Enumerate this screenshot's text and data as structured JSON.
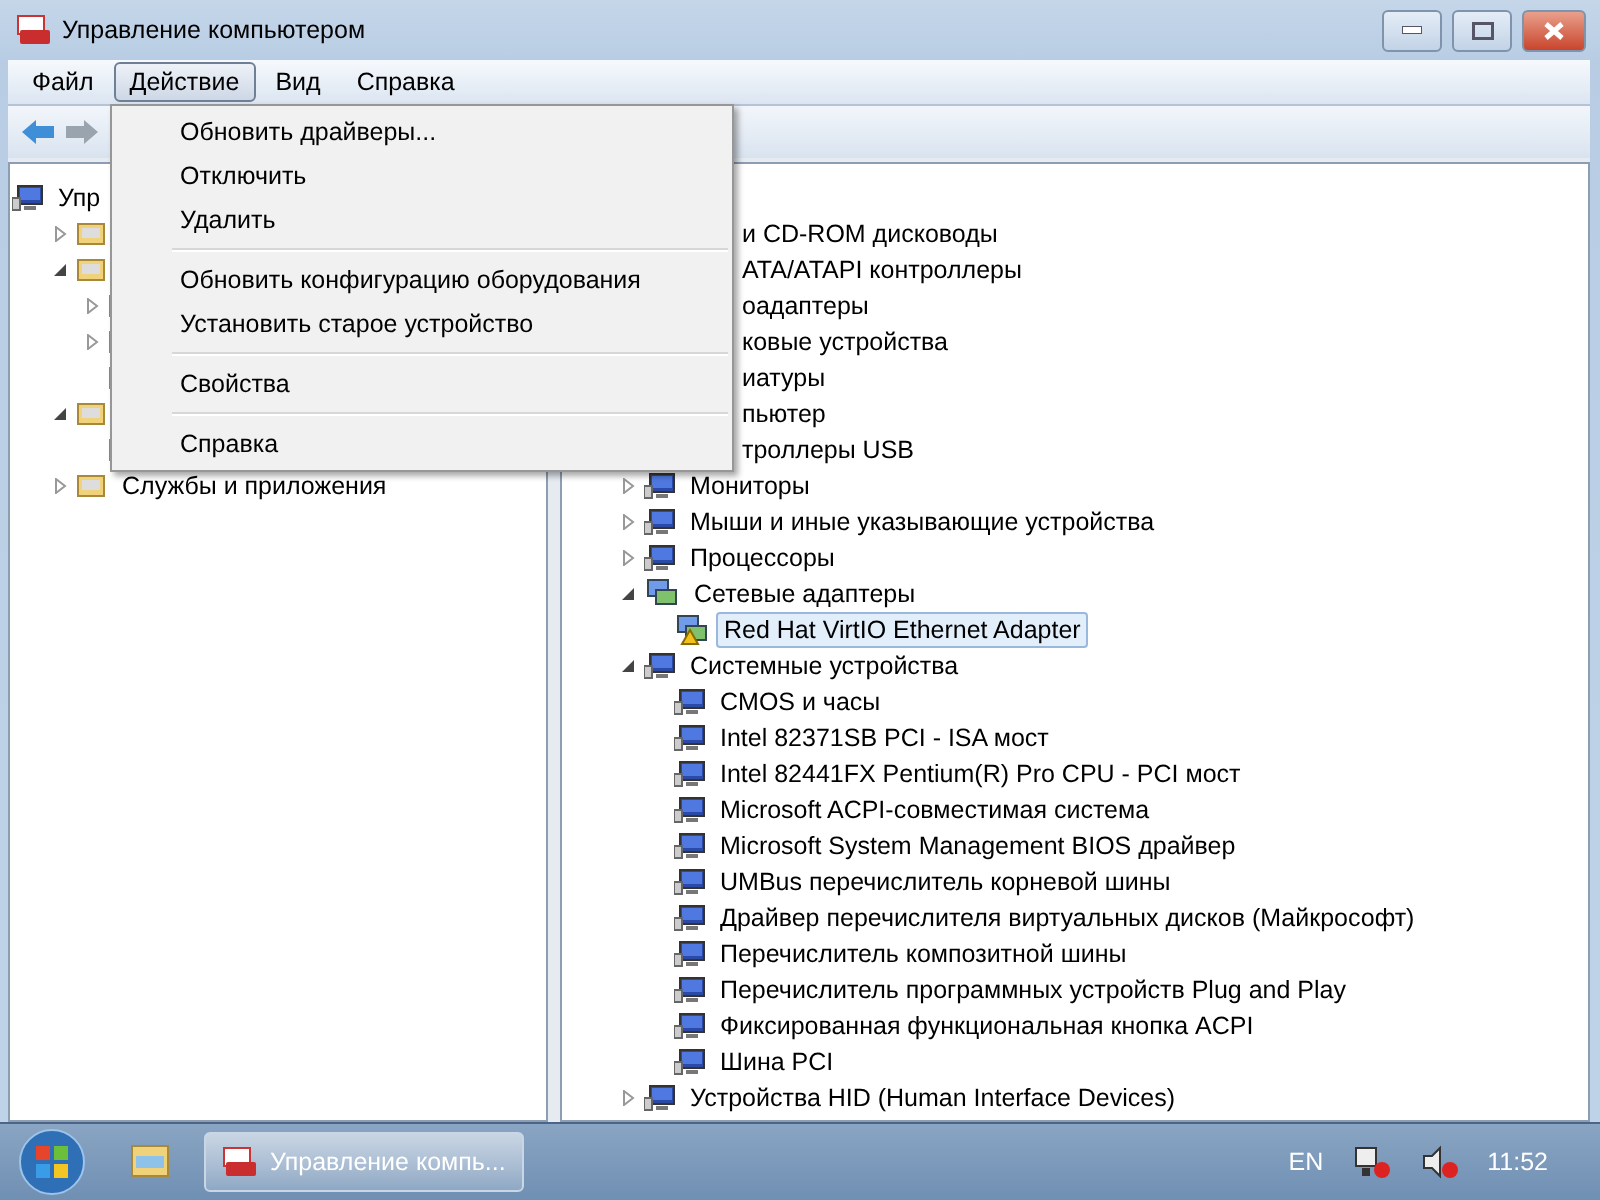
{
  "window": {
    "title": "Управление компьютером"
  },
  "menubar": [
    {
      "label": "Файл",
      "selected": false
    },
    {
      "label": "Действие",
      "selected": true
    },
    {
      "label": "Вид",
      "selected": false
    },
    {
      "label": "Справка",
      "selected": false
    }
  ],
  "action_menu": [
    {
      "kind": "item",
      "label": "Обновить драйверы..."
    },
    {
      "kind": "item",
      "label": "Отключить"
    },
    {
      "kind": "item",
      "label": "Удалить"
    },
    {
      "kind": "separator"
    },
    {
      "kind": "item",
      "label": "Обновить конфигурацию оборудования"
    },
    {
      "kind": "item",
      "label": "Установить старое устройство"
    },
    {
      "kind": "separator"
    },
    {
      "kind": "item",
      "label": "Свойства"
    },
    {
      "kind": "separator"
    },
    {
      "kind": "item",
      "label": "Справка"
    }
  ],
  "console_tree": [
    {
      "label": "Упр",
      "children": [
        {
          "expanded": false
        },
        {
          "expanded": true,
          "children": [
            {
              "expanded": false
            },
            {
              "expanded": false
            },
            {
              "kind": "leaf"
            }
          ]
        },
        {
          "expanded": true,
          "children": [
            {
              "kind": "leaf"
            }
          ]
        },
        {
          "label": "Службы и приложения",
          "expanded": false
        }
      ]
    }
  ],
  "device_tree": [
    {
      "label": "и CD-ROM дисководы",
      "covered": true
    },
    {
      "label": "ATA/ATAPI контроллеры",
      "covered": true
    },
    {
      "label": "оадаптеры",
      "covered": true
    },
    {
      "label": "ковые устройства",
      "covered": true
    },
    {
      "label": "иатуры",
      "covered": true
    },
    {
      "label": "пьютер",
      "covered": true
    },
    {
      "label": "троллеры USB",
      "covered": true
    },
    {
      "label": "Мониторы",
      "expanded": false
    },
    {
      "label": "Мыши и иные указывающие устройства",
      "expanded": false
    },
    {
      "label": "Процессоры",
      "expanded": false
    },
    {
      "label": "Сетевые адаптеры",
      "expanded": true,
      "children": [
        {
          "label": "Red Hat VirtIO Ethernet Adapter",
          "selected": true,
          "warning": true
        }
      ]
    },
    {
      "label": "Системные устройства",
      "expanded": true,
      "children": [
        {
          "label": "CMOS и часы",
          "selected": false
        },
        {
          "label": "Intel 82371SB PCI - ISA мост",
          "selected": false
        },
        {
          "label": "Intel 82441FX Pentium(R) Pro CPU - PCI мост",
          "selected": false
        },
        {
          "label": "Microsoft ACPI-совместимая система",
          "selected": false
        },
        {
          "label": "Microsoft System Management BIOS драйвер",
          "selected": false
        },
        {
          "label": "UMBus перечислитель корневой шины",
          "selected": false
        },
        {
          "label": "Драйвер перечислителя виртуальных дисков (Майкрософт)",
          "selected": false
        },
        {
          "label": "Перечислитель композитной шины",
          "selected": false
        },
        {
          "label": "Перечислитель программных устройств Plug and Play",
          "selected": false
        },
        {
          "label": "Фиксированная функциональная кнопка ACPI",
          "selected": false
        },
        {
          "label": "Шина PCI",
          "selected": false
        }
      ]
    },
    {
      "label": "Устройства HID (Human Interface Devices)",
      "expanded": false
    }
  ],
  "taskbar": {
    "task": "Управление компь...",
    "language": "EN",
    "clock": "11:52"
  }
}
